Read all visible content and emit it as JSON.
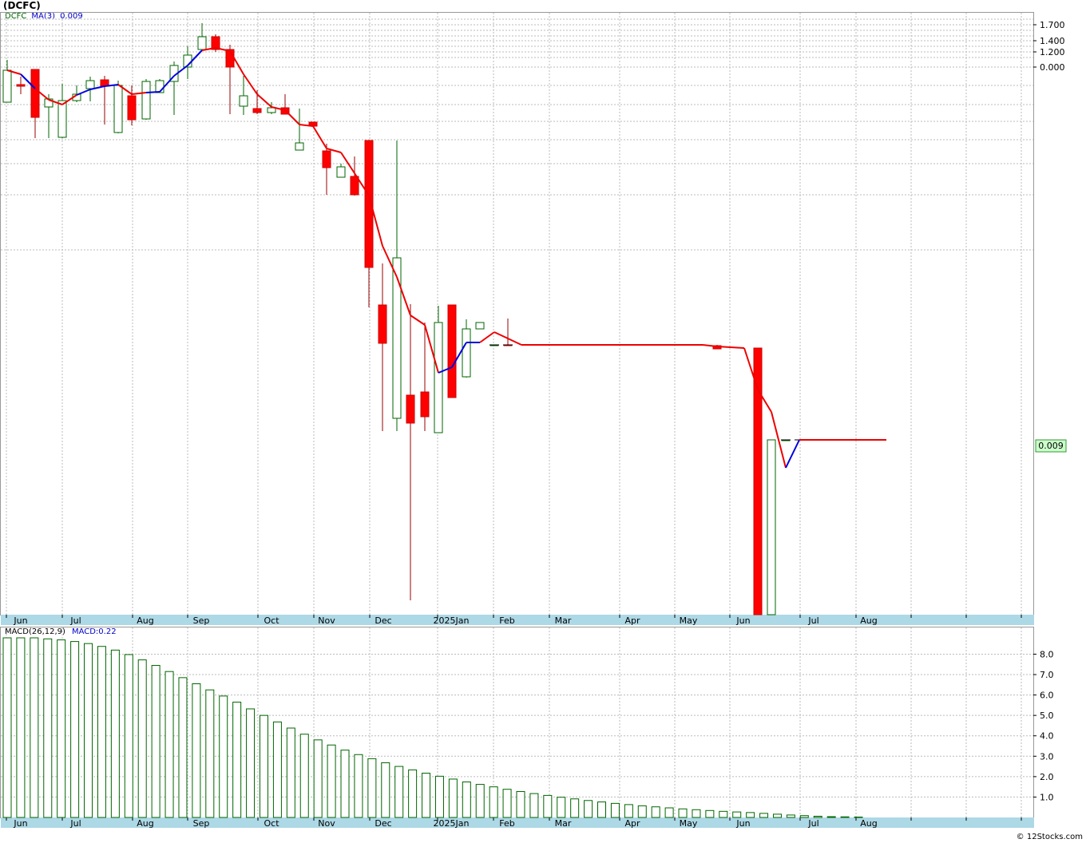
{
  "header": {
    "title": "(DCFC)",
    "symbol": "DCFC",
    "ma_label": "MA(3)",
    "ma_value": "0.009"
  },
  "macd_header": {
    "label": "MACD(26,12,9)",
    "value": "MACD:0.22"
  },
  "footer": {
    "text": "© 12Stocks.com"
  },
  "colors": {
    "up_candle": "#006600",
    "down_candle": "#ff0000",
    "ma_up": "#0000dd",
    "ma_down": "#ee0000",
    "axis_band": "#add8e6",
    "grid": "#bbbbbb",
    "price_tag_bg": "#ccffcc"
  },
  "chart_data": [
    {
      "type": "candlestick",
      "title": "",
      "price_axis_labels": [
        "1.700",
        "1.400",
        "1.200",
        "0.000"
      ],
      "last_price_label": "0.009",
      "month_labels": [
        "Jun",
        "Jul",
        "Aug",
        "Sep",
        "Oct",
        "Nov",
        "Dec",
        "2025Jan",
        "Feb",
        "Mar",
        "Apr",
        "May",
        "Jun",
        "Jul",
        "Aug"
      ],
      "grid": true,
      "series": [
        {
          "name": "MA(3)",
          "last_value": 0.009
        }
      ]
    },
    {
      "type": "bar",
      "title": "MACD(26,12,9)",
      "current_value_label": "MACD:0.22",
      "ylim": [
        0,
        8.8
      ],
      "y_ticks": [
        "8.0",
        "7.0",
        "6.0",
        "5.0",
        "4.0",
        "3.0",
        "2.0",
        "1.0"
      ],
      "values": [
        8.8,
        8.8,
        8.8,
        8.75,
        8.7,
        8.62,
        8.52,
        8.38,
        8.2,
        7.98,
        7.72,
        7.45,
        7.15,
        6.85,
        6.55,
        6.25,
        5.95,
        5.65,
        5.32,
        5.0,
        4.68,
        4.38,
        4.08,
        3.8,
        3.55,
        3.3,
        3.08,
        2.88,
        2.68,
        2.5,
        2.33,
        2.17,
        2.02,
        1.88,
        1.74,
        1.62,
        1.5,
        1.38,
        1.27,
        1.17,
        1.08,
        0.99,
        0.91,
        0.83,
        0.76,
        0.69,
        0.63,
        0.57,
        0.52,
        0.47,
        0.42,
        0.38,
        0.34,
        0.3,
        0.27,
        0.24,
        0.2,
        0.16,
        0.12,
        0.09,
        0.06,
        0.04,
        0.03,
        0.02
      ]
    }
  ]
}
